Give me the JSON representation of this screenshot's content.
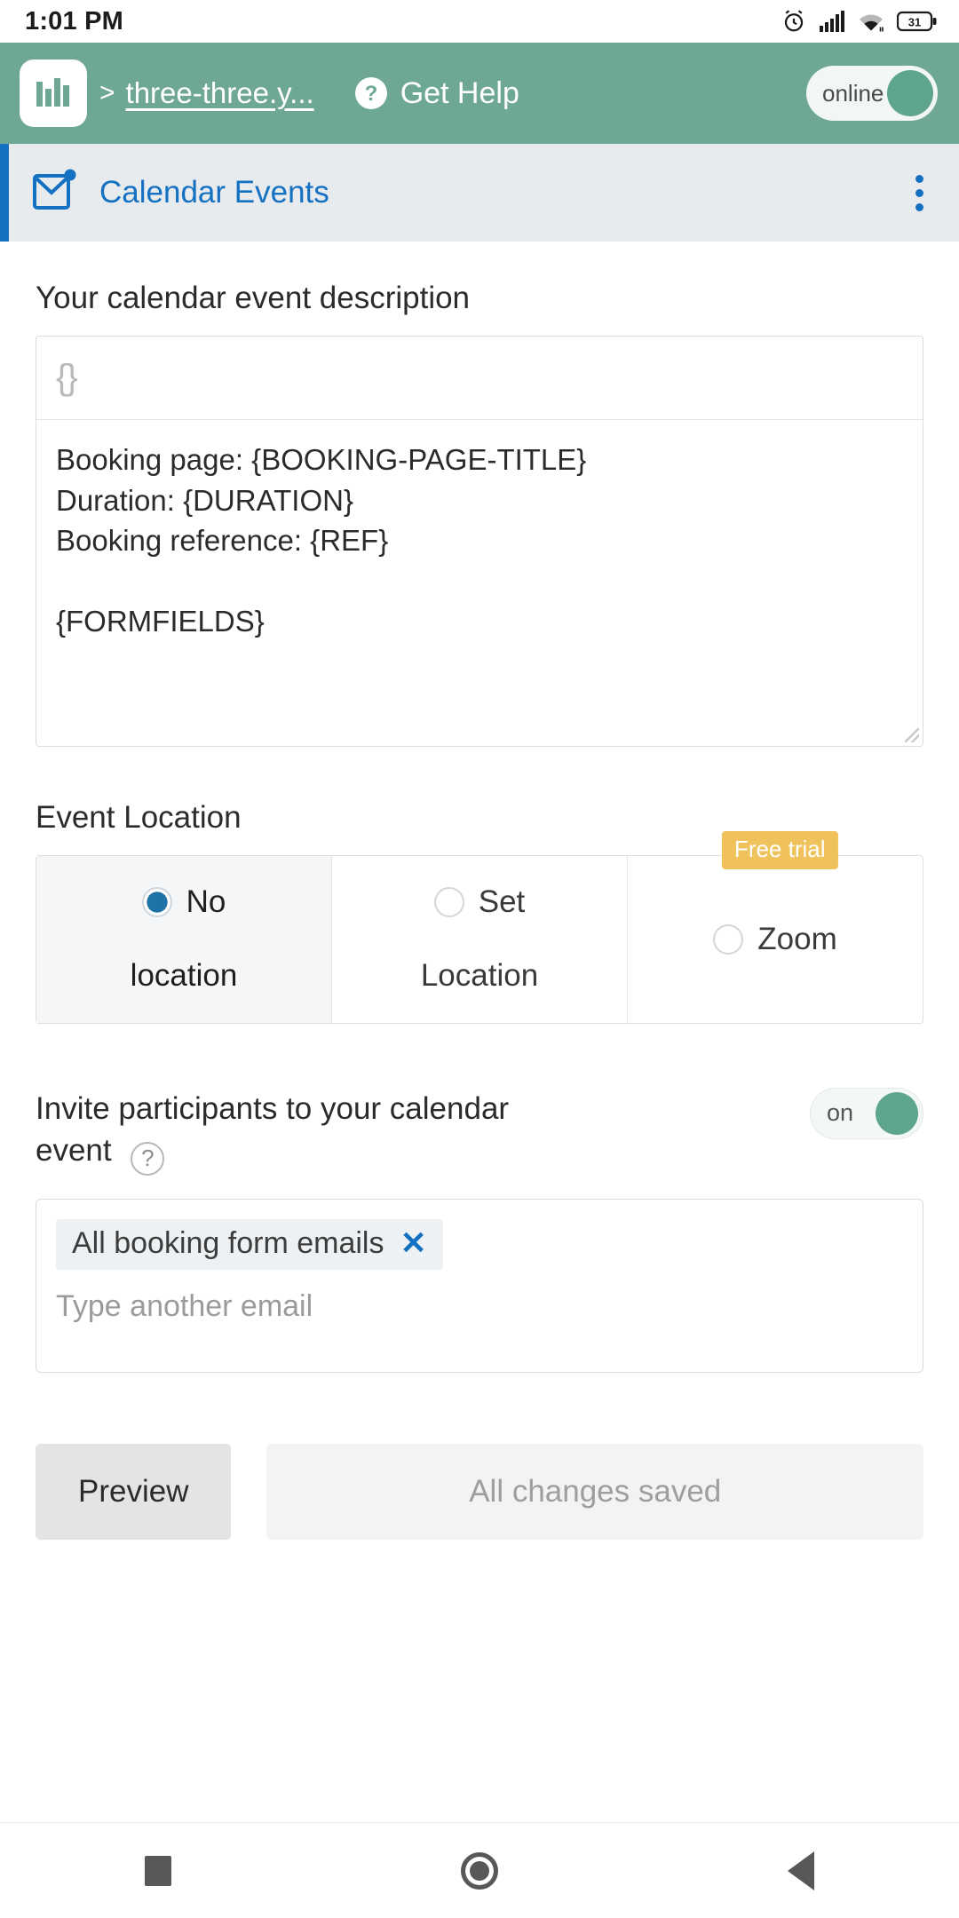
{
  "statusbar": {
    "time": "1:01 PM",
    "battery_level": "31",
    "icons": [
      "alarm-icon",
      "cellular-signal-icon",
      "wifi-icon",
      "battery-icon"
    ]
  },
  "appbar": {
    "logo": "bar-chart-logo",
    "breadcrumb_separator": ">",
    "site_link": "three-three.y...",
    "help_label": "Get Help",
    "help_icon": "question-mark-icon",
    "status_toggle": {
      "label": "online",
      "on": true,
      "knob_color": "#5da58c"
    },
    "background_color": "#6fa795"
  },
  "section": {
    "icon": "envelope-notification-icon",
    "title": "Calendar Events",
    "accent_color": "#1470c0",
    "menu_icon": "kebab-menu-icon"
  },
  "description": {
    "label": "Your calendar event description",
    "toolbar_icon": "{}",
    "value": "Booking page: {BOOKING-PAGE-TITLE}\nDuration: {DURATION}\nBooking reference: {REF}\n\n{FORMFIELDS}"
  },
  "event_location": {
    "title": "Event Location",
    "options": [
      {
        "label_line1": "No",
        "label_line2": "location",
        "selected": true,
        "badge": null
      },
      {
        "label_line1": "Set",
        "label_line2": "Location",
        "selected": false,
        "badge": null
      },
      {
        "label_line1": "Zoom",
        "label_line2": "",
        "selected": false,
        "badge": "Free trial"
      }
    ],
    "badge_color": "#efc25c"
  },
  "invite": {
    "label": "Invite participants to your calendar event",
    "help_icon": "question-circle-icon",
    "toggle": {
      "label": "on",
      "on": true
    },
    "chips": [
      {
        "label": "All booking form emails",
        "remove_icon": "close-x-icon"
      }
    ],
    "input_placeholder": "Type another email"
  },
  "actions": {
    "preview_label": "Preview",
    "saved_label": "All changes saved"
  },
  "navbar": {
    "recents_icon": "square-recents-icon",
    "home_icon": "circle-home-icon",
    "back_icon": "triangle-back-icon"
  }
}
